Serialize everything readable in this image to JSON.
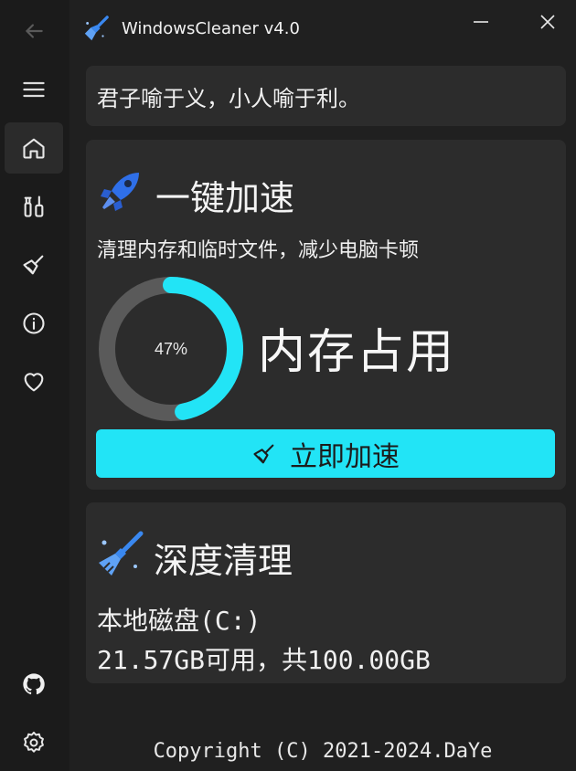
{
  "app": {
    "title": "WindowsCleaner v4.0"
  },
  "quote": "君子喻于义，小人喻于利。",
  "boost": {
    "title": "一键加速",
    "description": "清理内存和临时文件，减少电脑卡顿",
    "memory_percent_label": "47%",
    "memory_percent": 0.47,
    "memory_label": "内存占用",
    "button_label": "立即加速"
  },
  "deep_clean": {
    "title": "深度清理",
    "disk_name": "本地磁盘(C:)",
    "disk_space": "21.57GB可用，共100.00GB"
  },
  "footer": {
    "copyright": "Copyright (C) 2021-2024.DaYe"
  },
  "nav": {
    "items": [
      "back-icon",
      "menu-icon",
      "home-icon",
      "tools-icon",
      "broom-icon",
      "info-icon",
      "heart-icon",
      "github-icon",
      "settings-icon"
    ],
    "active": "home-icon"
  },
  "colors": {
    "accent": "#22e4f6",
    "rocket": "#2f6fe8",
    "background": "#202020",
    "card": "#2c2c2c"
  }
}
